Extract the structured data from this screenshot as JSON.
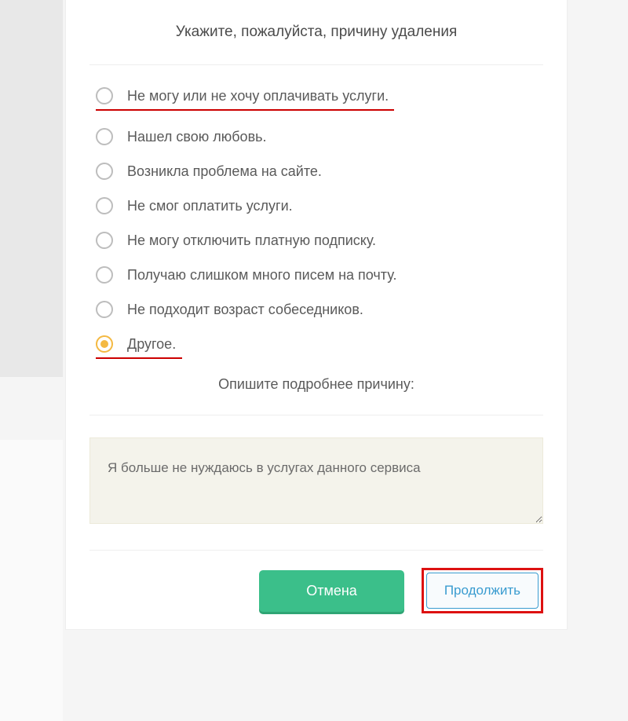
{
  "dialog": {
    "title": "Укажите, пожалуйста, причину удаления",
    "subtitle": "Опишите подробнее причину:",
    "options": [
      {
        "label": "Не могу или не хочу оплачивать услуги.",
        "selected": false,
        "highlighted": true
      },
      {
        "label": "Нашел свою любовь.",
        "selected": false,
        "highlighted": false
      },
      {
        "label": "Возникла проблема на сайте.",
        "selected": false,
        "highlighted": false
      },
      {
        "label": "Не смог оплатить услуги.",
        "selected": false,
        "highlighted": false
      },
      {
        "label": "Не могу отключить платную подписку.",
        "selected": false,
        "highlighted": false
      },
      {
        "label": "Получаю слишком много писем на почту.",
        "selected": false,
        "highlighted": false
      },
      {
        "label": "Не подходит возраст собеседников.",
        "selected": false,
        "highlighted": false
      },
      {
        "label": "Другое.",
        "selected": true,
        "highlighted": true
      }
    ],
    "reason_text": "Я больше не нуждаюсь в услугах данного сервиса",
    "buttons": {
      "cancel": "Отмена",
      "continue": "Продолжить"
    }
  }
}
